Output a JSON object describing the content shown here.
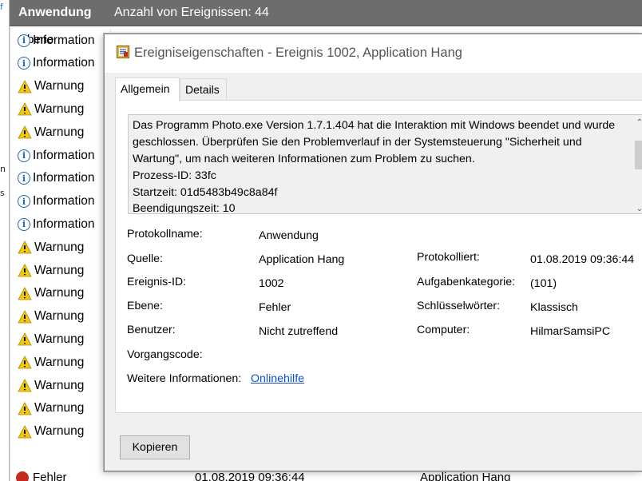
{
  "bg": {
    "log_name": "Anwendung",
    "event_count_text": "Anzahl von Ereignissen: 44",
    "column_level": "Ebene",
    "rows": [
      {
        "level": "Information",
        "icon": "info-icon"
      },
      {
        "level": "Information",
        "icon": "info-icon"
      },
      {
        "level": "Warnung",
        "icon": "warning-icon"
      },
      {
        "level": "Warnung",
        "icon": "warning-icon"
      },
      {
        "level": "Warnung",
        "icon": "warning-icon"
      },
      {
        "level": "Information",
        "icon": "info-icon"
      },
      {
        "level": "Information",
        "icon": "info-icon"
      },
      {
        "level": "Information",
        "icon": "info-icon"
      },
      {
        "level": "Information",
        "icon": "info-icon"
      },
      {
        "level": "Warnung",
        "icon": "warning-icon"
      },
      {
        "level": "Warnung",
        "icon": "warning-icon"
      },
      {
        "level": "Warnung",
        "icon": "warning-icon"
      },
      {
        "level": "Warnung",
        "icon": "warning-icon"
      },
      {
        "level": "Warnung",
        "icon": "warning-icon"
      },
      {
        "level": "Warnung",
        "icon": "warning-icon"
      },
      {
        "level": "Warnung",
        "icon": "warning-icon"
      },
      {
        "level": "Warnung",
        "icon": "warning-icon"
      },
      {
        "level": "Warnung",
        "icon": "warning-icon"
      }
    ],
    "bottom_row": {
      "level": "Fehler",
      "date": "01.08.2019 09:36:44",
      "source": "Application Hang"
    },
    "left_fragments": [
      "f",
      "n",
      "s"
    ]
  },
  "dialog": {
    "title": "Ereigniseigenschaften - Ereignis 1002, Application Hang",
    "tabs": [
      "Allgemein",
      "Details"
    ],
    "description_lines": [
      "Das Programm Photo.exe Version 1.7.1.404 hat die Interaktion mit Windows beendet und wurde",
      "geschlossen. Überprüfen Sie den Problemverlauf in der Systemsteuerung \"Sicherheit und",
      "Wartung\", um nach weiteren Informationen zum Problem zu suchen.",
      " Prozess-ID: 33fc",
      " Startzeit: 01d5483b49c8a84f",
      " Beendigungszeit: 10"
    ],
    "fields": {
      "protokollname_label": "Protokollname:",
      "protokollname_value": "Anwendung",
      "quelle_label": "Quelle:",
      "quelle_value": "Application Hang",
      "protokolliert_label": "Protokolliert:",
      "protokolliert_value": "01.08.2019 09:36:44",
      "ereignis_id_label": "Ereignis-ID:",
      "ereignis_id_value": "1002",
      "aufgabenkategorie_label": "Aufgabenkategorie:",
      "aufgabenkategorie_value": "(101)",
      "ebene_label": "Ebene:",
      "ebene_value": "Fehler",
      "schluesselwoerter_label": "Schlüsselwörter:",
      "schluesselwoerter_value": "Klassisch",
      "benutzer_label": "Benutzer:",
      "benutzer_value": "Nicht zutreffend",
      "computer_label": "Computer:",
      "computer_value": "HilmarSamsiPC",
      "vorgangscode_label": "Vorgangscode:",
      "weitere_label": "Weitere Informationen:",
      "weitere_link": "Onlinehilfe"
    },
    "copy_button": "Kopieren"
  },
  "colors": {
    "header_bg": "#6d6d6d",
    "dialog_bg": "#f0f0f0",
    "link": "#0b4fcf",
    "warning": "#f2c811",
    "info": "#1f63b5",
    "error": "#c42b1c"
  }
}
